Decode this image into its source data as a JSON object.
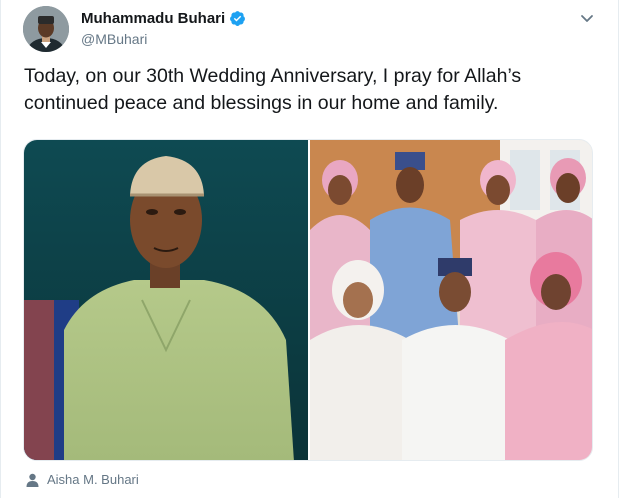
{
  "tweet": {
    "author": {
      "display_name": "Muhammadu Buhari",
      "handle": "@MBuhari",
      "verified": true
    },
    "text": "Today, on our 30th Wedding Anniversary, I pray for Allah’s continued peace and blessings in our home and family.",
    "media": [
      {
        "kind": "photo",
        "depicts": "vintage portrait of man in cap and green kaftan"
      },
      {
        "kind": "photo",
        "depicts": "family group photo"
      }
    ],
    "tagged_user": "Aisha M. Buhari"
  },
  "colors": {
    "text_primary": "#14171a",
    "text_secondary": "#657786",
    "verified_blue": "#1da1f2",
    "border": "#e6ecf0"
  },
  "icons": {
    "verified": "verified-badge-icon",
    "caret": "chevron-down-icon",
    "tag": "person-icon"
  }
}
